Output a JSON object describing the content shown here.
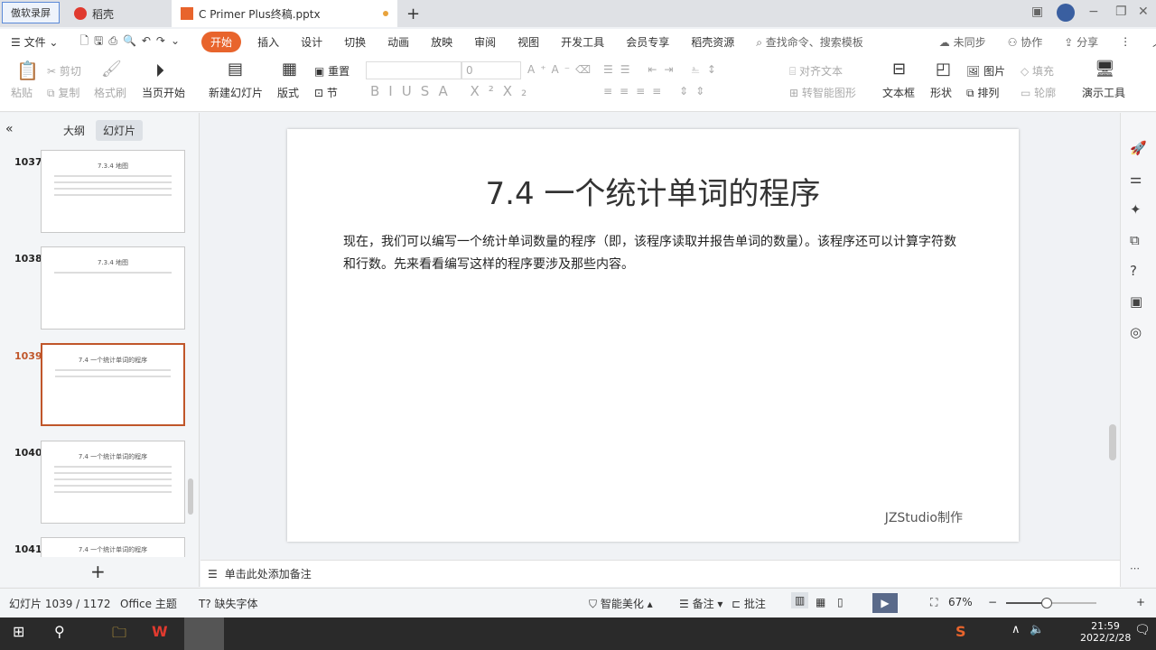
{
  "titlebar": {
    "recorder": "傲软录屏",
    "tabs": [
      {
        "label": "稻壳"
      },
      {
        "label": "C Primer  Plus终稿.pptx"
      }
    ],
    "new_tab": "+"
  },
  "menubar": {
    "file": "文件",
    "items": [
      "开始",
      "插入",
      "设计",
      "切换",
      "动画",
      "放映",
      "审阅",
      "视图",
      "开发工具",
      "会员专享",
      "稻壳资源"
    ],
    "search": "查找命令、搜索模板",
    "sync": "未同步",
    "collab": "协作",
    "share": "分享"
  },
  "ribbon": {
    "paste": "粘贴",
    "cut": "剪切",
    "copy": "复制",
    "format_painter": "格式刷",
    "play_current": "当页开始",
    "new_slide": "新建幻灯片",
    "layout": "版式",
    "reset": "重置",
    "section": "节",
    "font_size": "0",
    "align_text": "对齐文本",
    "smartart": "转智能图形",
    "textbox": "文本框",
    "shape": "形状",
    "picture": "图片",
    "fill": "填充",
    "arrange": "排列",
    "outline": "轮廓",
    "tools": "演示工具"
  },
  "leftpanel": {
    "tab_outline": "大纲",
    "tab_slides": "幻灯片",
    "slides": [
      {
        "num": "1037",
        "title": "7.3.4 地图"
      },
      {
        "num": "1038",
        "title": "7.3.4 地图"
      },
      {
        "num": "1039",
        "title": "7.4 一个统计单词的程序"
      },
      {
        "num": "1040",
        "title": "7.4 一个统计单词的程序"
      },
      {
        "num": "1041",
        "title": "7.4 一个统计单词的程序"
      }
    ],
    "add": "+"
  },
  "slide": {
    "title": "7.4 一个统计单词的程序",
    "body": "现在，我们可以编写一个统计单词数量的程序（即，该程序读取并报告单词的数量）。该程序还可以计算字符数和行数。先来看看编写这样的程序要涉及那些内容。",
    "footer": "JZStudio制作"
  },
  "notes": {
    "placeholder": "单击此处添加备注"
  },
  "status": {
    "slide_counter": "幻灯片 1039 / 1172",
    "theme": "Office 主题",
    "missing_font": "缺失字体",
    "beautify": "智能美化",
    "notes": "备注",
    "comment": "批注",
    "zoom": "67%",
    "zoom_fraction": 0.45
  },
  "taskbar": {
    "time": "21:59",
    "date": "2022/2/28"
  },
  "colors": {
    "accent": "#e8642c",
    "selected": "#c0562a"
  }
}
